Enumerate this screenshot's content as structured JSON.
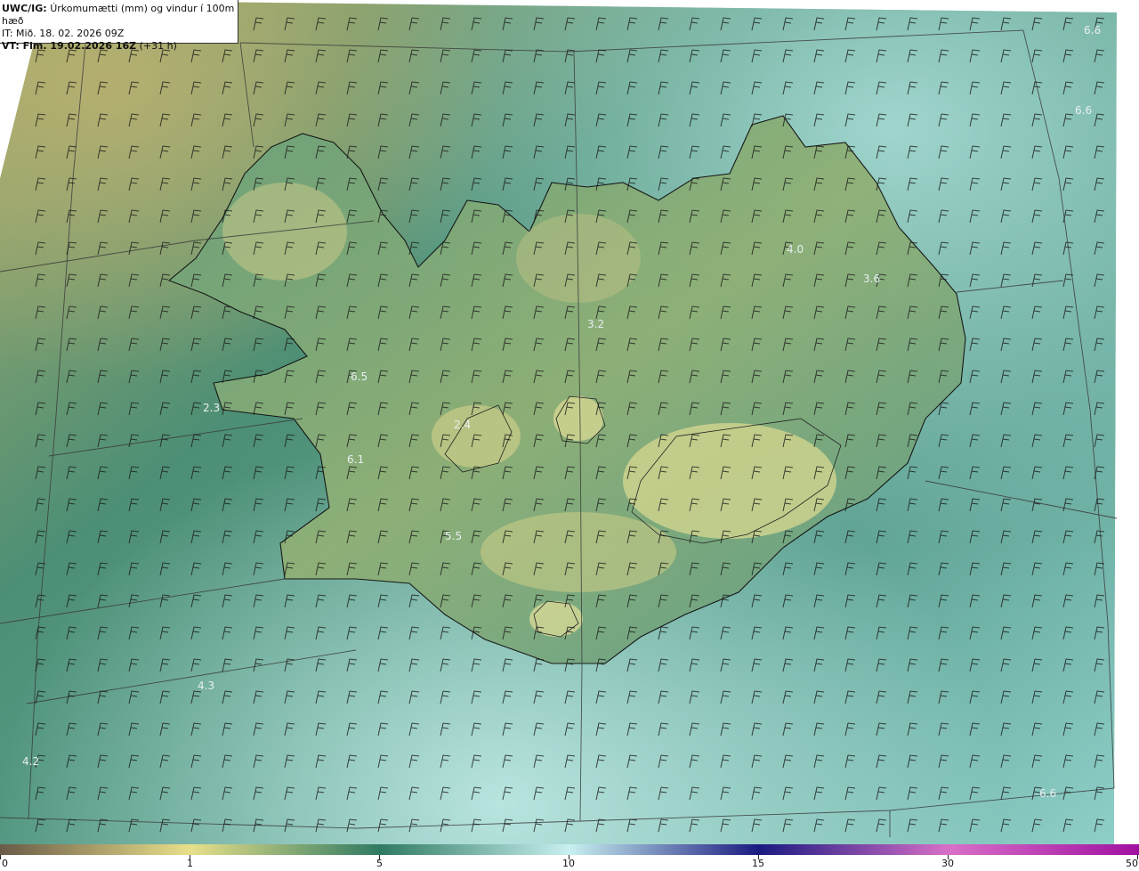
{
  "header": {
    "model": "UWC/IG:",
    "title": "Úrkomumætti (mm) og vindur í 100m hæð",
    "it": "IT: Mið. 18. 02. 2026 09Z",
    "vt_label": "VT: Fim. 19.02.2026 16Z",
    "vt_offset": "(+31 h)"
  },
  "map_values": [
    {
      "id": "v1",
      "text": "6.6"
    },
    {
      "id": "v2",
      "text": "6.6"
    },
    {
      "id": "v3",
      "text": "4.0"
    },
    {
      "id": "v4",
      "text": "3.6"
    },
    {
      "id": "v5",
      "text": "3.2"
    },
    {
      "id": "v6",
      "text": "6.5"
    },
    {
      "id": "v7",
      "text": "2.3"
    },
    {
      "id": "v8",
      "text": "2.4"
    },
    {
      "id": "v9",
      "text": "6.1"
    },
    {
      "id": "v10",
      "text": "5.5"
    },
    {
      "id": "v11",
      "text": "4.3"
    },
    {
      "id": "v12",
      "text": "4.2"
    },
    {
      "id": "v13",
      "text": "6.6"
    }
  ],
  "colorbar": {
    "labels": [
      "0",
      "1",
      "5",
      "10",
      "15",
      "30",
      "50"
    ],
    "colors": [
      "#6b5a48",
      "#e8e08a",
      "#2f7a62",
      "#c8f0f0",
      "#1a1a80",
      "#d870c8",
      "#a010a0"
    ]
  }
}
